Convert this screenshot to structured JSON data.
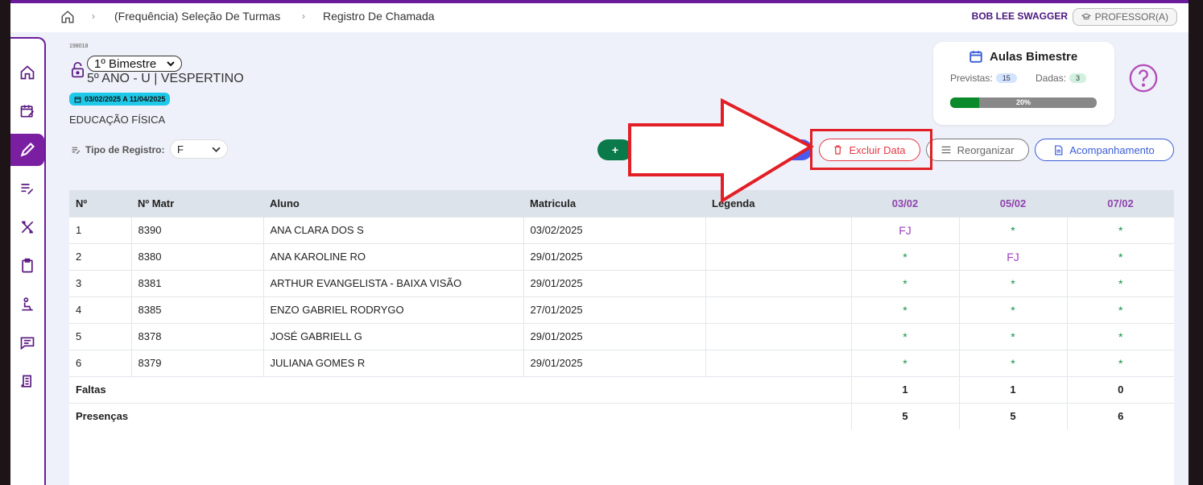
{
  "breadcrumb": {
    "items": [
      "(Frequência) Seleção De Turmas",
      "Registro De Chamada"
    ]
  },
  "user": {
    "name": "BOB LEE SWAGGER",
    "role": "PROFESSOR(A)"
  },
  "header": {
    "id": "198018",
    "bimestre": "1º Bimestre",
    "turma": "5º ANO - U | VESPERTINO",
    "period": "03/02/2025 A 11/04/2025",
    "subject": "EDUCAÇÃO FÍSICA",
    "tipo_label": "Tipo de Registro:",
    "tipo_value": "F"
  },
  "stats": {
    "title": "Aulas Bimestre",
    "previstas_label": "Previstas:",
    "previstas_value": "15",
    "dadas_label": "Dadas:",
    "dadas_value": "3",
    "progress_text": "20%",
    "progress_fraction": 0.2
  },
  "actions": {
    "add_label": "+",
    "excluir_label": "Excluir Data",
    "reorganizar_label": "Reorganizar",
    "acompanhamento_label": "Acompanhamento"
  },
  "table": {
    "headers": [
      "Nº",
      "Nº Matr",
      "Aluno",
      "Matricula",
      "Legenda",
      "03/02",
      "05/02",
      "07/02"
    ],
    "rows": [
      {
        "n": "1",
        "matr": "8390",
        "aluno": "ANA CLARA DOS S",
        "matricula": "03/02/2025",
        "marks": [
          "FJ",
          "*",
          "*"
        ]
      },
      {
        "n": "2",
        "matr": "8380",
        "aluno": "ANA KAROLINE RO",
        "matricula": "29/01/2025",
        "marks": [
          "*",
          "FJ",
          "*"
        ]
      },
      {
        "n": "3",
        "matr": "8381",
        "aluno": "ARTHUR EVANGELISTA - BAIXA VISÃO",
        "matricula": "29/01/2025",
        "marks": [
          "*",
          "*",
          "*"
        ]
      },
      {
        "n": "4",
        "matr": "8385",
        "aluno": "ENZO GABRIEL RODRYGO",
        "matricula": "27/01/2025",
        "marks": [
          "*",
          "*",
          "*"
        ]
      },
      {
        "n": "5",
        "matr": "8378",
        "aluno": "JOSÉ GABRIELL G",
        "matricula": "29/01/2025",
        "marks": [
          "*",
          "*",
          "*"
        ]
      },
      {
        "n": "6",
        "matr": "8379",
        "aluno": "JULIANA GOMES R",
        "matricula": "29/01/2025",
        "marks": [
          "*",
          "*",
          "*"
        ]
      }
    ],
    "faltas_label": "Faltas",
    "faltas": [
      "1",
      "1",
      "0"
    ],
    "presencas_label": "Presenças",
    "presencas": [
      "5",
      "5",
      "6"
    ]
  },
  "colors": {
    "brand": "#6a1b9a",
    "present": "#17904a",
    "justified": "#9b3fbf",
    "danger": "#e53946",
    "highlight": "#e21f26"
  }
}
